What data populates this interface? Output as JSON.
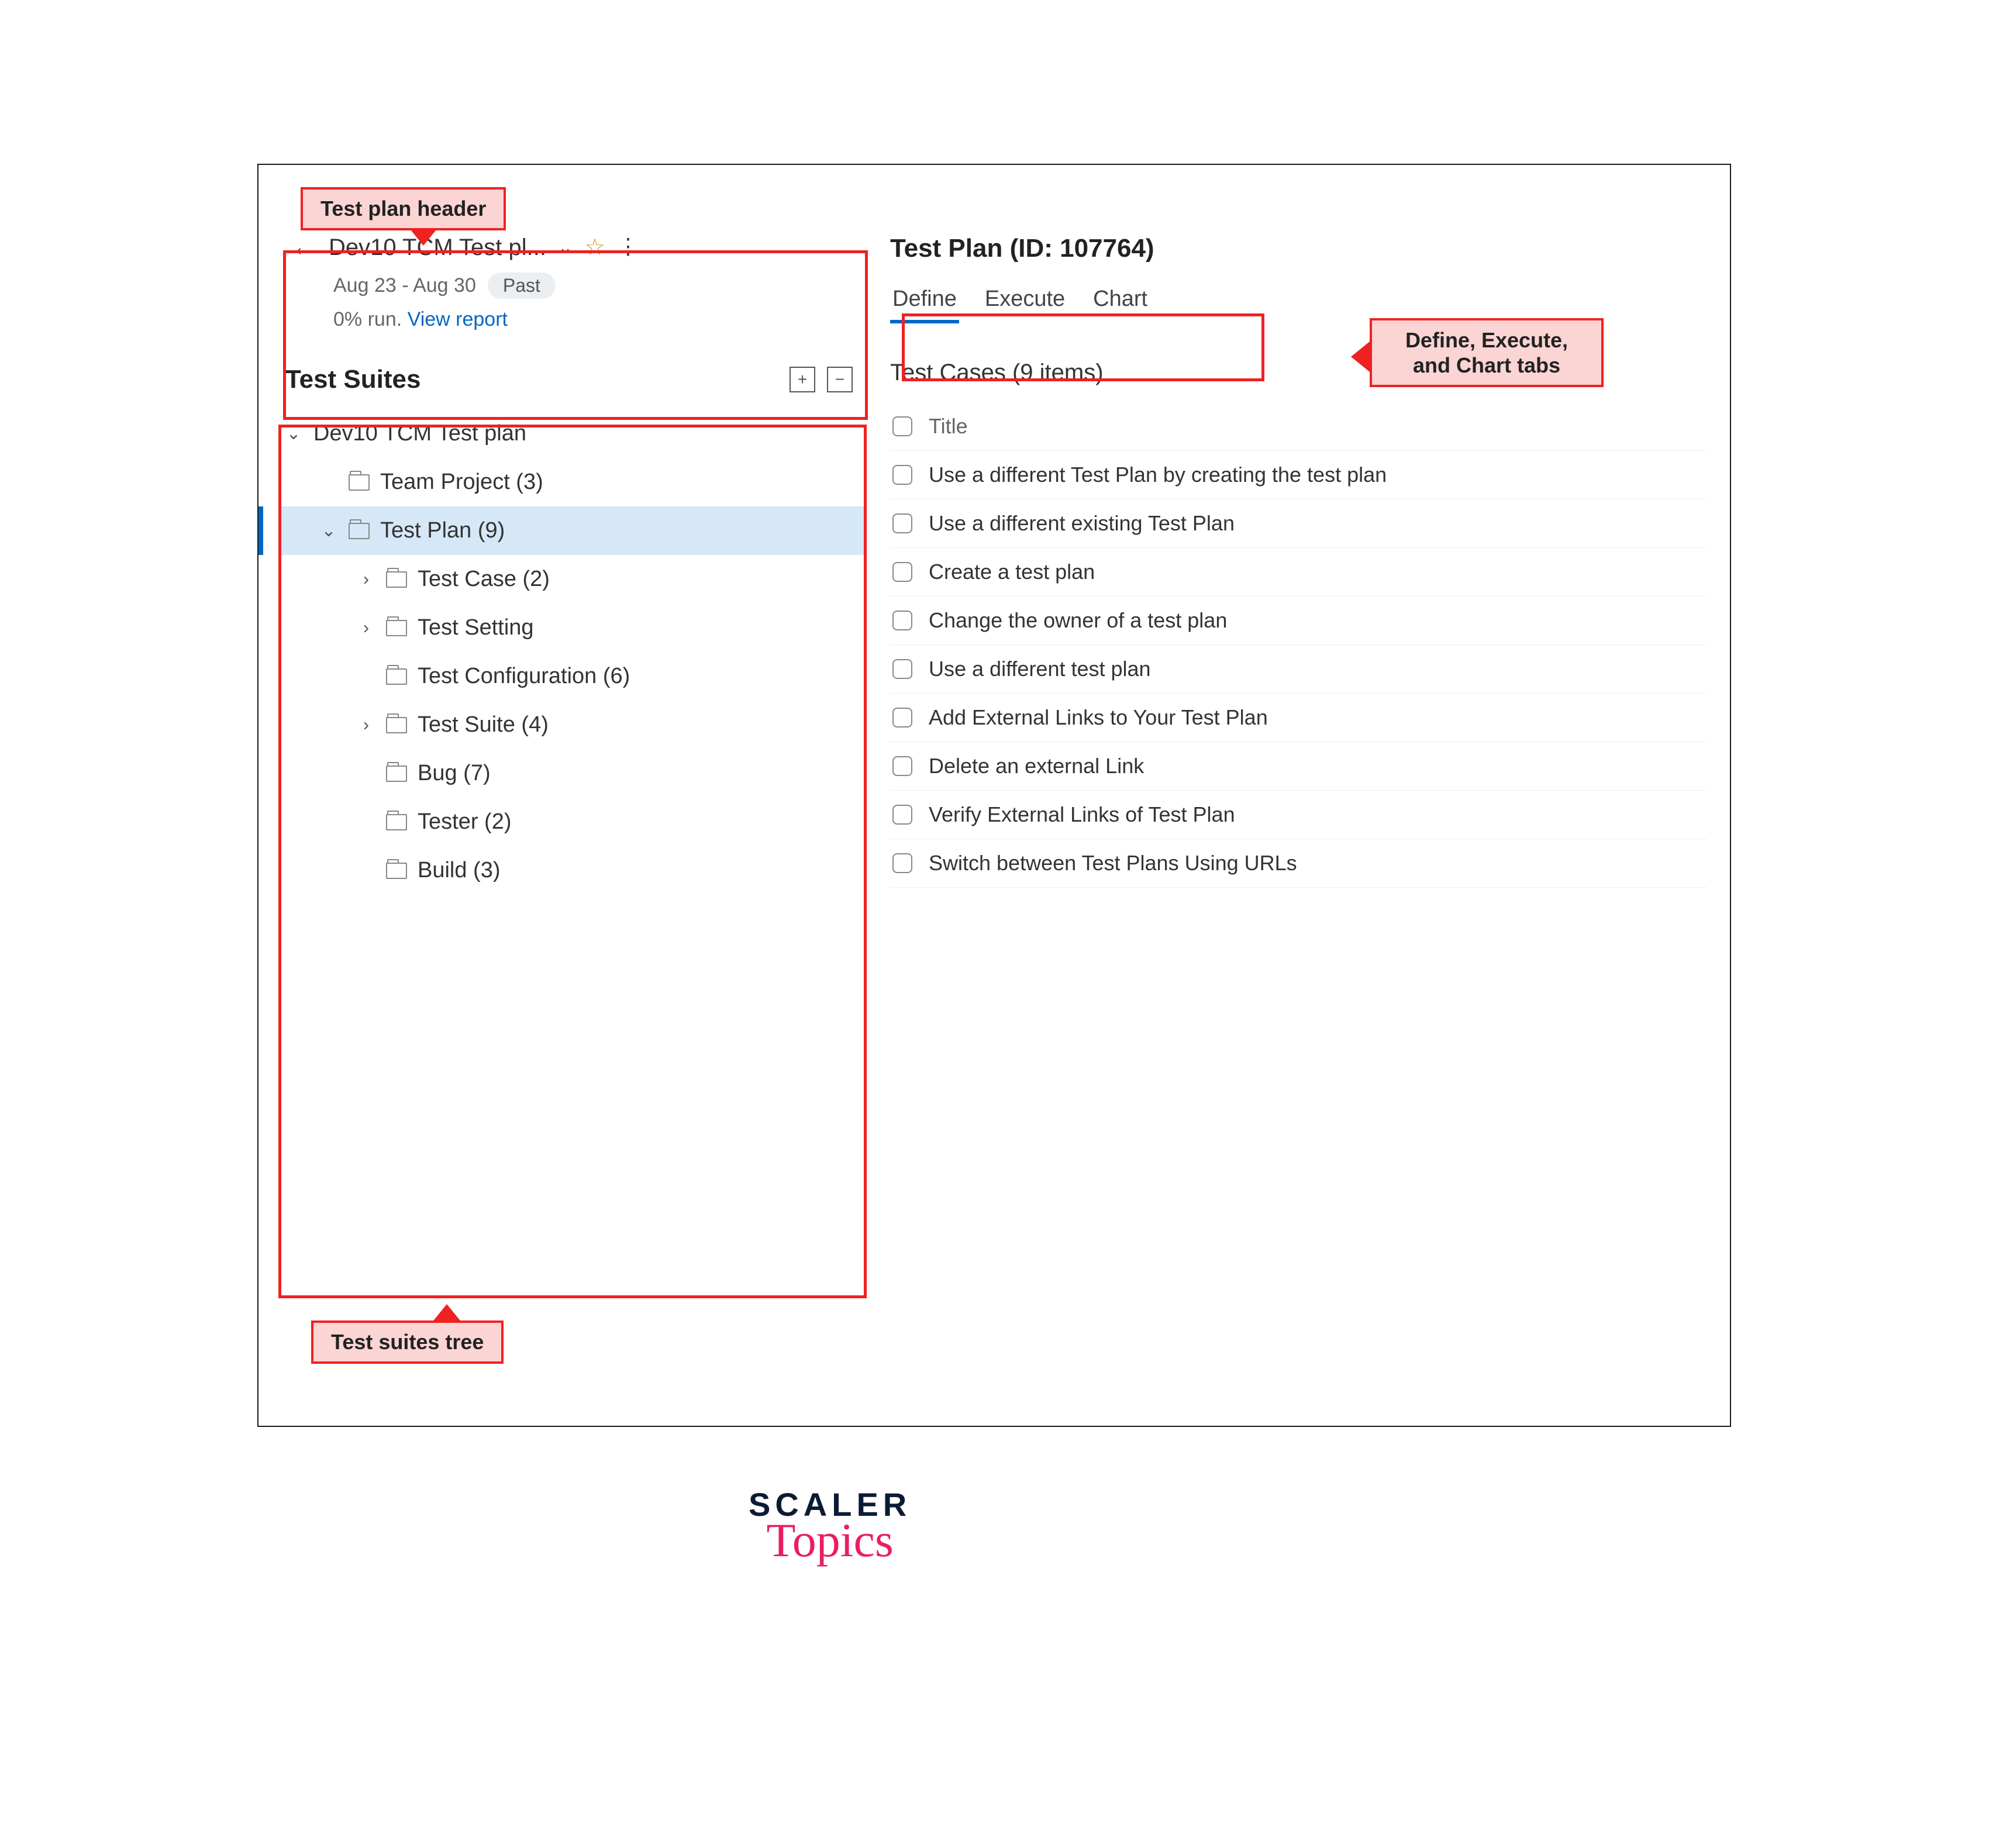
{
  "callouts": {
    "plan_header": "Test plan header",
    "tabs": "Define, Execute, and Chart tabs",
    "suites_tree": "Test suites tree"
  },
  "header": {
    "plan_name": "Dev10 TCM Test pl...",
    "date_range": "Aug 23 - Aug 30",
    "past_badge": "Past",
    "run_status": "0% run.",
    "view_report": "View report"
  },
  "suites": {
    "title": "Test Suites",
    "tree": {
      "root": "Dev10 TCM Test plan",
      "items": [
        {
          "label": "Team Project (3)",
          "expandable": false
        },
        {
          "label": "Test Plan (9)",
          "expandable": true,
          "selected": true
        },
        {
          "label": "Test Case (2)",
          "expandable": true
        },
        {
          "label": "Test Setting",
          "expandable": true
        },
        {
          "label": "Test Configuration (6)",
          "expandable": false
        },
        {
          "label": "Test Suite (4)",
          "expandable": true
        },
        {
          "label": "Bug (7)",
          "expandable": false
        },
        {
          "label": "Tester (2)",
          "expandable": false
        },
        {
          "label": "Build (3)",
          "expandable": false
        }
      ]
    }
  },
  "main": {
    "title": "Test Plan (ID: 107764)",
    "tabs": [
      {
        "label": "Define",
        "active": true
      },
      {
        "label": "Execute",
        "active": false
      },
      {
        "label": "Chart",
        "active": false
      }
    ],
    "cases_title": "Test Cases (9 items)",
    "column_header": "Title",
    "cases": [
      "Use a different Test Plan by creating the test plan",
      "Use a different existing Test Plan",
      "Create a test plan",
      "Change the owner of a test plan",
      "Use a different test plan",
      "Add External Links to Your Test Plan",
      "Delete an external Link",
      "Verify External Links of Test Plan",
      "Switch between Test Plans Using URLs"
    ]
  },
  "logo": {
    "line1": "SCALER",
    "line2": "Topics"
  }
}
